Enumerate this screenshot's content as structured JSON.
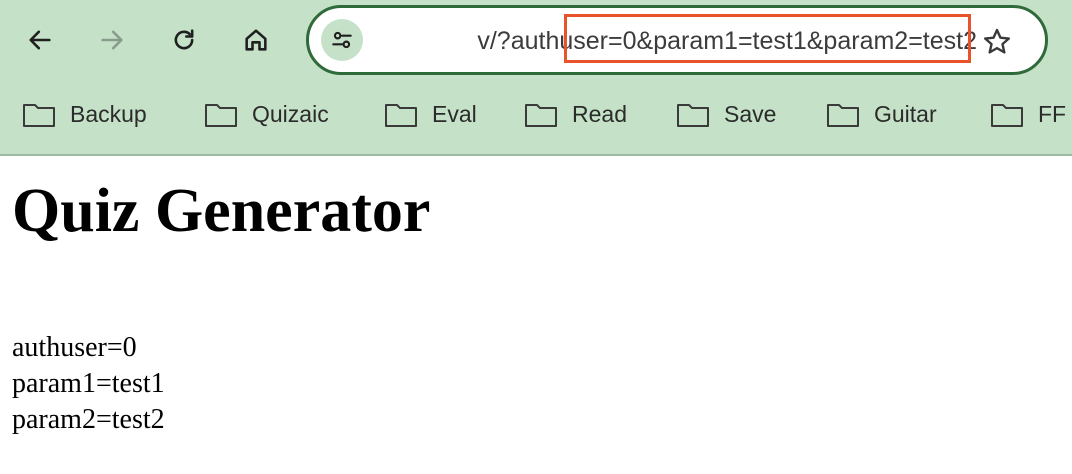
{
  "toolbar": {
    "back_icon": "arrow-left-icon",
    "forward_icon": "arrow-right-icon",
    "reload_icon": "reload-icon",
    "home_icon": "home-icon"
  },
  "omnibox": {
    "url_prefix": "v/?authuser=0",
    "url_highlighted": "&param1=test1&param2=test2",
    "highlight_color": "#e8532c",
    "border_color": "#2f6a3a"
  },
  "bookmarks": [
    {
      "label": "Backup"
    },
    {
      "label": "Quizaic"
    },
    {
      "label": "Eval"
    },
    {
      "label": "Read"
    },
    {
      "label": "Save"
    },
    {
      "label": "Guitar"
    },
    {
      "label": "FF"
    }
  ],
  "page": {
    "title": "Quiz Generator",
    "params": [
      "authuser=0",
      "param1=test1",
      "param2=test2"
    ]
  },
  "colors": {
    "chrome_bg": "#c5e2c8",
    "text": "#000000"
  }
}
